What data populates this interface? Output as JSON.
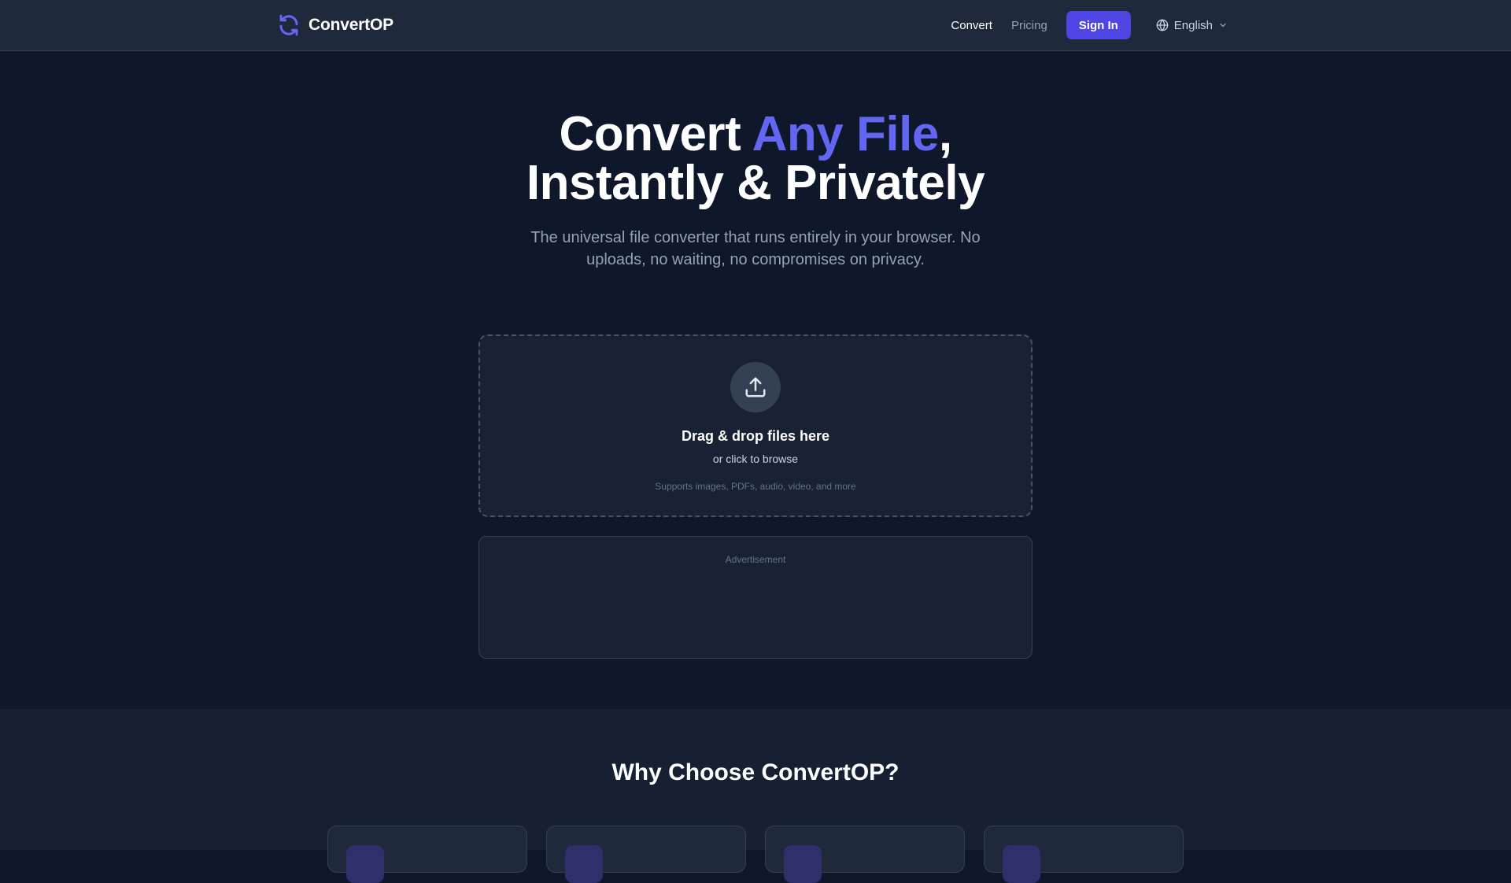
{
  "brand": {
    "name": "ConvertOP",
    "icon": "refresh-icon",
    "color": "#6366f1"
  },
  "nav": {
    "links": [
      {
        "label": "Convert",
        "active": true
      },
      {
        "label": "Pricing",
        "active": false
      }
    ],
    "signin_label": "Sign In",
    "language": "English",
    "accent": "#4f46e5"
  },
  "hero": {
    "title_part1": "Convert ",
    "title_accent": "Any File",
    "title_part2": ",",
    "title_line2": "Instantly & Privately",
    "subtitle": "The universal file converter that runs entirely in your browser. No uploads, no waiting, no compromises on privacy."
  },
  "dropzone": {
    "icon": "upload-icon",
    "title": "Drag & drop files here",
    "subtitle": "or click to browse",
    "note": "Supports images, PDFs, audio, video, and more"
  },
  "ad": {
    "label": "Advertisement"
  },
  "why": {
    "title": "Why Choose ConvertOP?",
    "cards": 4
  }
}
